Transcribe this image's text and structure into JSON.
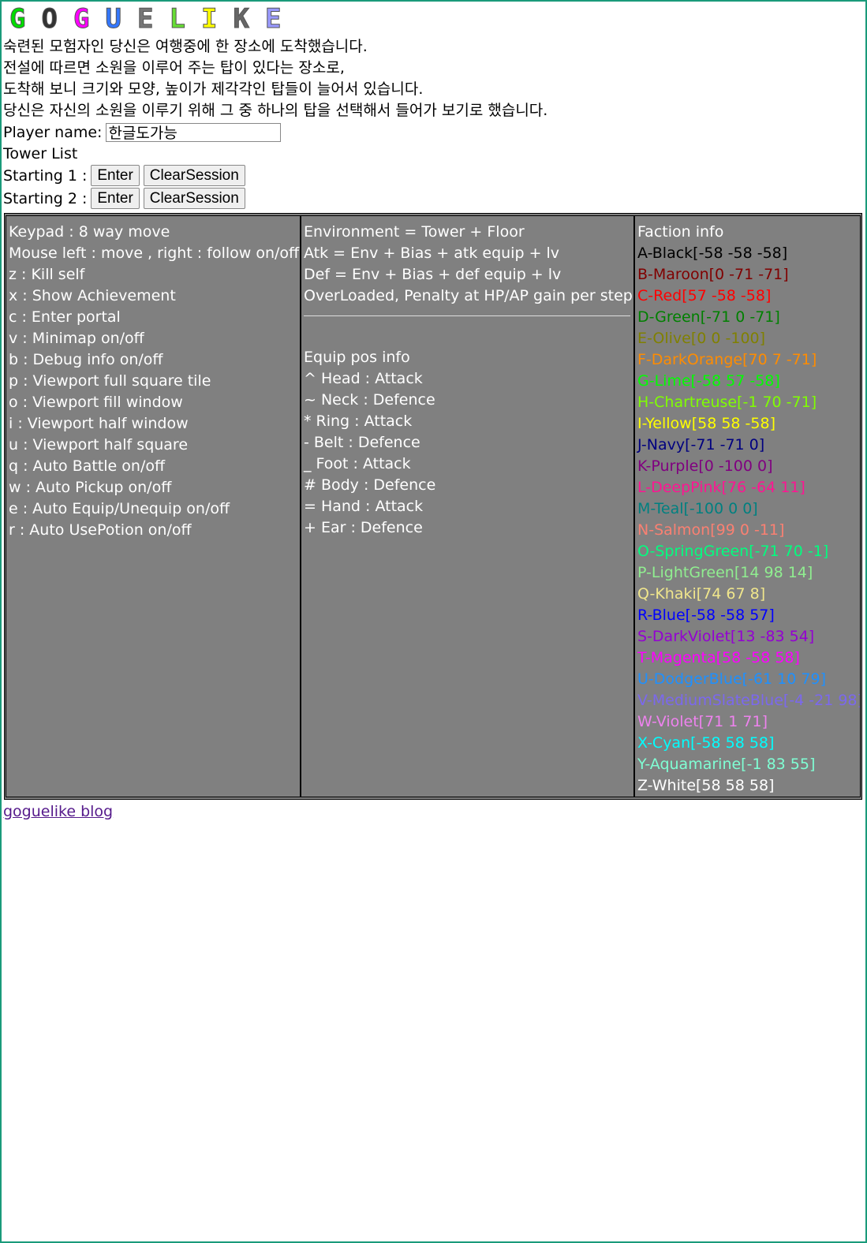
{
  "logo": [
    {
      "ch": "G",
      "color": "#00dd00"
    },
    {
      "ch": "O",
      "color": "#333333"
    },
    {
      "ch": "G",
      "color": "#ff00ff"
    },
    {
      "ch": "U",
      "color": "#3377ff"
    },
    {
      "ch": "E",
      "color": "#777777"
    },
    {
      "ch": "L",
      "color": "#66dd33"
    },
    {
      "ch": "I",
      "color": "#ffff00"
    },
    {
      "ch": "K",
      "color": "#666666"
    },
    {
      "ch": "E",
      "color": "#9999ff"
    }
  ],
  "intro": [
    "숙련된 모험자인 당신은 여행중에 한 장소에 도착했습니다.",
    "전설에 따르면 소원을 이루어 주는 탑이 있다는 장소로,",
    "도착해 보니 크기와 모양, 높이가 제각각인 탑들이 늘어서 있습니다.",
    "당신은 자신의 소원을 이루기 위해 그 중 하나의 탑을 선택해서 들어가 보기로 했습니다."
  ],
  "player": {
    "label": "Player name:",
    "value": "한글도가능"
  },
  "tower_list_label": "Tower List",
  "starting": [
    {
      "label": "Starting 1 :",
      "enter": "Enter",
      "clear": "ClearSession"
    },
    {
      "label": "Starting 2 :",
      "enter": "Enter",
      "clear": "ClearSession"
    }
  ],
  "keys": [
    "Keypad : 8 way move",
    "Mouse left : move , right : follow on/off",
    "z : Kill self",
    "x : Show Achievement",
    "c : Enter portal",
    "v : Minimap on/off",
    "b : Debug info on/off",
    "p : Viewport full square tile",
    "o : Viewport fill window",
    "i : Viewport half window",
    "u : Viewport half square",
    "q : Auto Battle on/off",
    "w : Auto Pickup on/off",
    "e : Auto Equip/Unequip on/off",
    "r : Auto UsePotion on/off"
  ],
  "formulas": [
    "Environment = Tower + Floor",
    "Atk = Env + Bias + atk equip + lv",
    "Def = Env + Bias + def equip + lv",
    "OverLoaded, Penalty at HP/AP gain per step"
  ],
  "equip_title": "Equip pos info",
  "equip": [
    "^ Head : Attack",
    "~ Neck : Defence",
    "* Ring : Attack",
    "- Belt : Defence",
    "_ Foot : Attack",
    "# Body : Defence",
    "= Hand : Attack",
    "+ Ear : Defence"
  ],
  "faction_title": "Faction info",
  "factions": [
    {
      "text": "A-Black[-58 -58 -58]",
      "color": "#000000"
    },
    {
      "text": "B-Maroon[0 -71 -71]",
      "color": "#800000"
    },
    {
      "text": "C-Red[57 -58 -58]",
      "color": "#ff0000"
    },
    {
      "text": "D-Green[-71 0 -71]",
      "color": "#008000"
    },
    {
      "text": "E-Olive[0 0 -100]",
      "color": "#808000"
    },
    {
      "text": "F-DarkOrange[70 7 -71]",
      "color": "#ff8c00"
    },
    {
      "text": "G-Lime[-58 57 -58]",
      "color": "#00ff00"
    },
    {
      "text": "H-Chartreuse[-1 70 -71]",
      "color": "#7fff00"
    },
    {
      "text": "I-Yellow[58 58 -58]",
      "color": "#ffff00"
    },
    {
      "text": "J-Navy[-71 -71 0]",
      "color": "#000080"
    },
    {
      "text": "K-Purple[0 -100 0]",
      "color": "#800080"
    },
    {
      "text": "L-DeepPink[76 -64 11]",
      "color": "#ff1493"
    },
    {
      "text": "M-Teal[-100 0 0]",
      "color": "#008080"
    },
    {
      "text": "N-Salmon[99 0 -11]",
      "color": "#fa8072"
    },
    {
      "text": "O-SpringGreen[-71 70 -1]",
      "color": "#00ff7f"
    },
    {
      "text": "P-LightGreen[14 98 14]",
      "color": "#90ee90"
    },
    {
      "text": "Q-Khaki[74 67 8]",
      "color": "#f0e68c"
    },
    {
      "text": "R-Blue[-58 -58 57]",
      "color": "#0000ff"
    },
    {
      "text": "S-DarkViolet[13 -83 54]",
      "color": "#9400d3"
    },
    {
      "text": "T-Magenta[58 -58 58]",
      "color": "#ff00ff"
    },
    {
      "text": "U-DodgerBlue[-61 10 79]",
      "color": "#1e90ff"
    },
    {
      "text": "V-MediumSlateBlue[-4 -21 98]",
      "color": "#7b68ee"
    },
    {
      "text": "W-Violet[71 1 71]",
      "color": "#ee82ee"
    },
    {
      "text": "X-Cyan[-58 58 58]",
      "color": "#00ffff"
    },
    {
      "text": "Y-Aquamarine[-1 83 55]",
      "color": "#7fffd4"
    },
    {
      "text": "Z-White[58 58 58]",
      "color": "#ffffff"
    }
  ],
  "blog_link": "goguelike blog"
}
